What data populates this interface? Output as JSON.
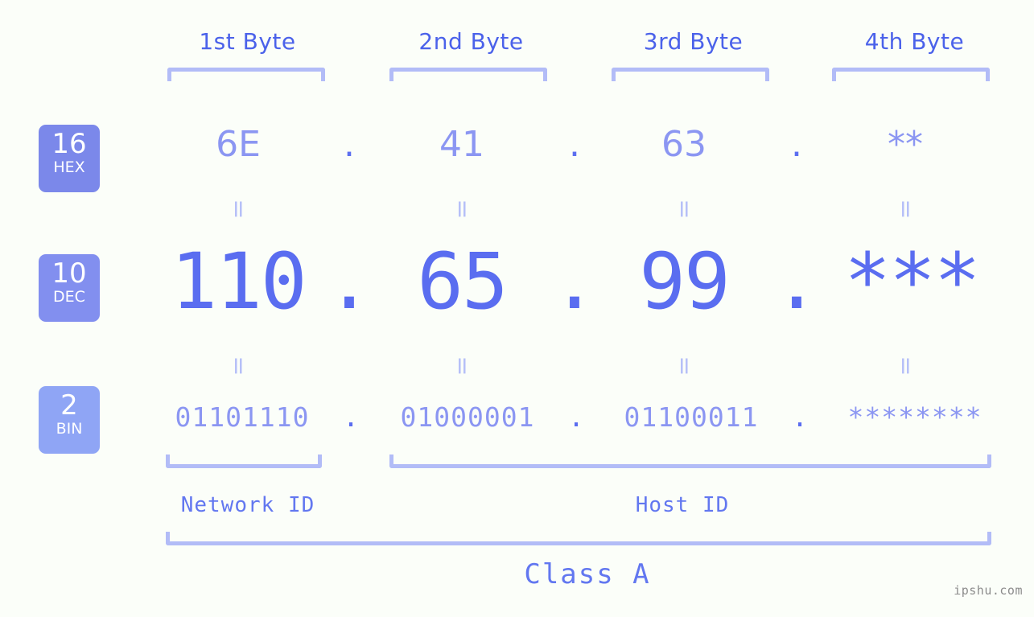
{
  "background_color": "#fbfef9",
  "accent_color": "#5a6df0",
  "accent_light": "#8b96f2",
  "bracket_color": "#b2bcf7",
  "byte_headers": [
    {
      "label": "1st Byte"
    },
    {
      "label": "2nd Byte"
    },
    {
      "label": "3rd Byte"
    },
    {
      "label": "4th Byte"
    }
  ],
  "bases": [
    {
      "number": "16",
      "name": "HEX",
      "color": "#7b88ea"
    },
    {
      "number": "10",
      "name": "DEC",
      "color": "#828fef"
    },
    {
      "number": "2",
      "name": "BIN",
      "color": "#8fa5f5"
    }
  ],
  "rows": {
    "hex": {
      "values": [
        "6E",
        "41",
        "63",
        "**"
      ],
      "separator": "."
    },
    "dec": {
      "values": [
        "110",
        "65",
        "99",
        "***"
      ],
      "separator": "."
    },
    "bin": {
      "values": [
        "01101110",
        "01000001",
        "01100011",
        "********"
      ],
      "separator": "."
    }
  },
  "connectors": {
    "glyph": "="
  },
  "footer": {
    "network_id": "Network ID",
    "host_id": "Host ID",
    "class": "Class A"
  },
  "watermark": "ipshu.com"
}
